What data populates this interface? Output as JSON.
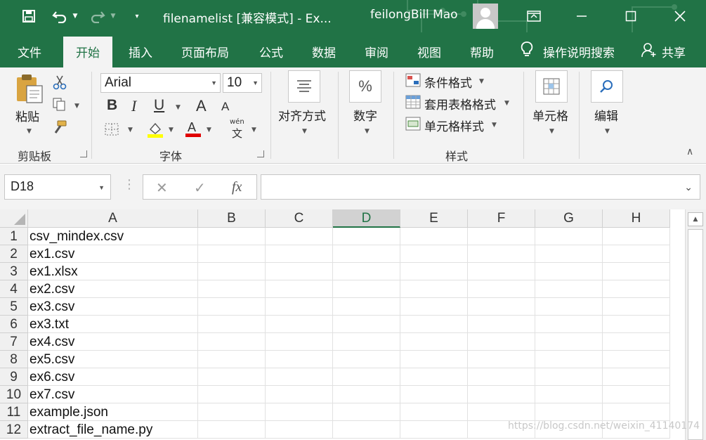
{
  "titlebar": {
    "title": "filenamelist  [兼容模式]  -  Ex...",
    "user": "feilongBill Mao",
    "bg": "#217346"
  },
  "tabs": [
    "文件",
    "开始",
    "插入",
    "页面布局",
    "公式",
    "数据",
    "审阅",
    "视图",
    "帮助"
  ],
  "active_tab": "开始",
  "tell_me": "操作说明搜索",
  "share": "共享",
  "ribbon": {
    "clipboard": {
      "paste": "粘贴",
      "label": "剪贴板"
    },
    "font": {
      "name": "Arial",
      "size": "10",
      "bold": "B",
      "italic": "I",
      "underline": "U",
      "grow": "A",
      "shrink": "A",
      "phonetic_top": "wén",
      "phonetic_bottom": "文",
      "label": "字体"
    },
    "alignment": {
      "label": "对齐方式"
    },
    "number": {
      "symbol": "%",
      "label": "数字"
    },
    "styles": {
      "conditional": "条件格式",
      "table": "套用表格格式",
      "cell": "单元格样式",
      "label": "样式"
    },
    "cells": {
      "label": "单元格"
    },
    "editing": {
      "label": "编辑"
    }
  },
  "formula_bar": {
    "name_box": "D18",
    "fx": "fx",
    "formula": ""
  },
  "grid": {
    "columns": [
      "A",
      "B",
      "C",
      "D",
      "E",
      "F",
      "G",
      "H"
    ],
    "selected_column": "D",
    "rows": [
      {
        "num": "1",
        "a": "csv_mindex.csv"
      },
      {
        "num": "2",
        "a": "ex1.csv"
      },
      {
        "num": "3",
        "a": "ex1.xlsx"
      },
      {
        "num": "4",
        "a": "ex2.csv"
      },
      {
        "num": "5",
        "a": "ex3.csv"
      },
      {
        "num": "6",
        "a": "ex3.txt"
      },
      {
        "num": "7",
        "a": "ex4.csv"
      },
      {
        "num": "8",
        "a": "ex5.csv"
      },
      {
        "num": "9",
        "a": "ex6.csv"
      },
      {
        "num": "10",
        "a": "ex7.csv"
      },
      {
        "num": "11",
        "a": "example.json"
      },
      {
        "num": "12",
        "a": "extract_file_name.py"
      }
    ]
  },
  "watermark": "https://blog.csdn.net/weixin_41140174"
}
